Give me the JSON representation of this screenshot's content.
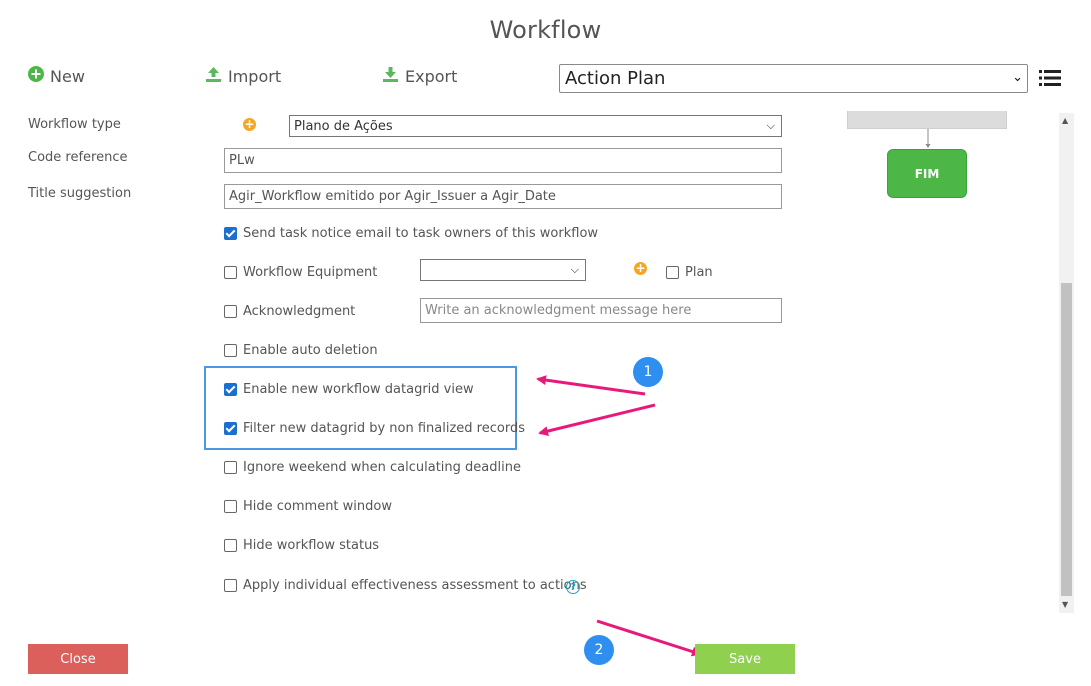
{
  "dialog": {
    "title": "Workflow"
  },
  "toolbar": {
    "new_label": "New",
    "import_label": "Import",
    "export_label": "Export",
    "selected_workflow": "Action Plan"
  },
  "form": {
    "workflow_type_label": "Workflow type",
    "workflow_type_value": "Plano de Ações",
    "code_reference_label": "Code reference",
    "code_reference_value": "PLw",
    "title_suggestion_label": "Title suggestion",
    "title_suggestion_value": "Agir_Workflow emitido por Agir_Issuer a Agir_Date",
    "send_task_notice": {
      "label": "Send task notice email to task owners of this workflow",
      "checked": true
    },
    "workflow_equipment": {
      "label": "Workflow Equipment",
      "checked": false,
      "select_value": ""
    },
    "plan": {
      "label": "Plan",
      "checked": false
    },
    "acknowledgment": {
      "label": "Acknowledgment",
      "checked": false,
      "placeholder": "Write an acknowledgment message here"
    },
    "enable_auto_deletion": {
      "label": "Enable auto deletion",
      "checked": false
    },
    "enable_new_datagrid": {
      "label": "Enable new workflow datagrid view",
      "checked": true
    },
    "filter_datagrid": {
      "label": "Filter new datagrid by non finalized records",
      "checked": true
    },
    "ignore_weekend": {
      "label": "Ignore weekend when calculating deadline",
      "checked": false
    },
    "hide_comment_window": {
      "label": "Hide comment window",
      "checked": false
    },
    "hide_workflow_status": {
      "label": "Hide workflow status",
      "checked": false
    },
    "apply_effectiveness": {
      "label": "Apply individual effectiveness assessment to actions",
      "checked": false
    }
  },
  "diagram": {
    "end_node_label": "FIM"
  },
  "annotations": {
    "badge_1": "1",
    "badge_2": "2"
  },
  "footer": {
    "close_label": "Close",
    "save_label": "Save"
  },
  "colors": {
    "accent_blue": "#2f8ff0",
    "arrow_pink": "#e8197a",
    "save_green": "#8fd14f",
    "close_red": "#d9534f",
    "fim_green": "#4cb747"
  }
}
